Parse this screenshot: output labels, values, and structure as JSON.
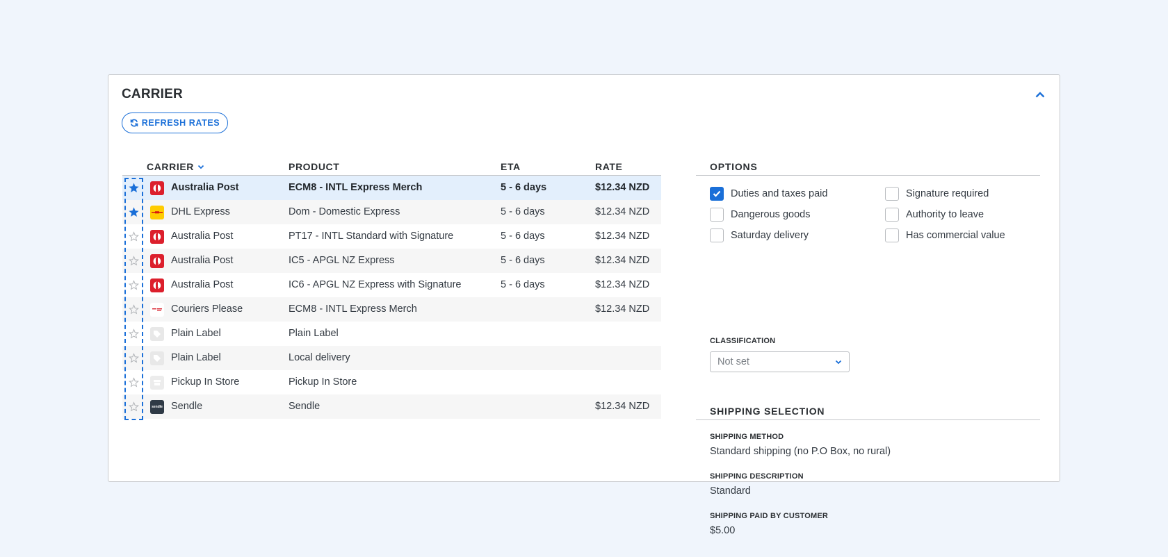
{
  "card": {
    "title": "CARRIER",
    "collapse_icon": "chevron-up-icon",
    "refresh_button": {
      "label": "REFRESH RATES",
      "icon": "refresh-icon"
    }
  },
  "table": {
    "headers": {
      "carrier": "CARRIER",
      "product": "PRODUCT",
      "eta": "ETA",
      "rate": "RATE"
    },
    "sort_icon": "chevron-down-icon",
    "rows": [
      {
        "favorite": true,
        "logo": "australia-post-logo",
        "carrier": "Australia Post",
        "product": "ECM8 - INTL Express Merch",
        "eta": "5 - 6 days",
        "rate": "$12.34 NZD",
        "selected": true
      },
      {
        "favorite": true,
        "logo": "dhl-logo",
        "carrier": "DHL Express",
        "product": "Dom - Domestic Express",
        "eta": "5 - 6 days",
        "rate": "$12.34 NZD",
        "selected": false
      },
      {
        "favorite": false,
        "logo": "australia-post-logo",
        "carrier": "Australia Post",
        "product": "PT17 - INTL Standard with Signature",
        "eta": "5 - 6 days",
        "rate": "$12.34 NZD",
        "selected": false
      },
      {
        "favorite": false,
        "logo": "australia-post-logo",
        "carrier": "Australia Post",
        "product": "IC5 - APGL NZ Express",
        "eta": "5 - 6 days",
        "rate": "$12.34 NZD",
        "selected": false
      },
      {
        "favorite": false,
        "logo": "australia-post-logo",
        "carrier": "Australia Post",
        "product": "IC6 - APGL NZ Express with Signature",
        "eta": "5 - 6 days",
        "rate": "$12.34 NZD",
        "selected": false
      },
      {
        "favorite": false,
        "logo": "couriers-please-logo",
        "carrier": "Couriers Please",
        "product": "ECM8 - INTL Express Merch",
        "eta": "",
        "rate": "$12.34 NZD",
        "selected": false
      },
      {
        "favorite": false,
        "logo": "plain-label-logo",
        "carrier": "Plain Label",
        "product": "Plain Label",
        "eta": "",
        "rate": "",
        "selected": false
      },
      {
        "favorite": false,
        "logo": "plain-label-logo",
        "carrier": "Plain Label",
        "product": "Local delivery",
        "eta": "",
        "rate": "",
        "selected": false
      },
      {
        "favorite": false,
        "logo": "pickup-store-logo",
        "carrier": "Pickup In Store",
        "product": "Pickup In Store",
        "eta": "",
        "rate": "",
        "selected": false
      },
      {
        "favorite": false,
        "logo": "sendle-logo",
        "carrier": "Sendle",
        "product": "Sendle",
        "eta": "",
        "rate": "$12.34 NZD",
        "selected": false
      }
    ],
    "sendle_logo_text": "sendle"
  },
  "options": {
    "title": "OPTIONS",
    "items": [
      {
        "label": "Duties and taxes paid",
        "checked": true
      },
      {
        "label": "Dangerous goods",
        "checked": false
      },
      {
        "label": "Saturday delivery",
        "checked": false
      },
      {
        "label": "Signature required",
        "checked": false
      },
      {
        "label": "Authority to leave",
        "checked": false
      },
      {
        "label": "Has commercial value",
        "checked": false
      }
    ],
    "classification": {
      "label": "CLASSIFICATION",
      "value": "Not set"
    }
  },
  "shipping_selection": {
    "title": "SHIPPING SELECTION",
    "fields": [
      {
        "label": "SHIPPING METHOD",
        "value": "Standard shipping (no P.O Box, no rural)"
      },
      {
        "label": "SHIPPING DESCRIPTION",
        "value": "Standard"
      },
      {
        "label": "SHIPPING PAID BY CUSTOMER",
        "value": "$5.00"
      }
    ]
  },
  "colors": {
    "accent": "#1a6fd8",
    "selected_row": "#e3effc",
    "page_background": "#f0f5fc",
    "australia_post": "#dc1f2c",
    "dhl": "#ffcc00"
  }
}
